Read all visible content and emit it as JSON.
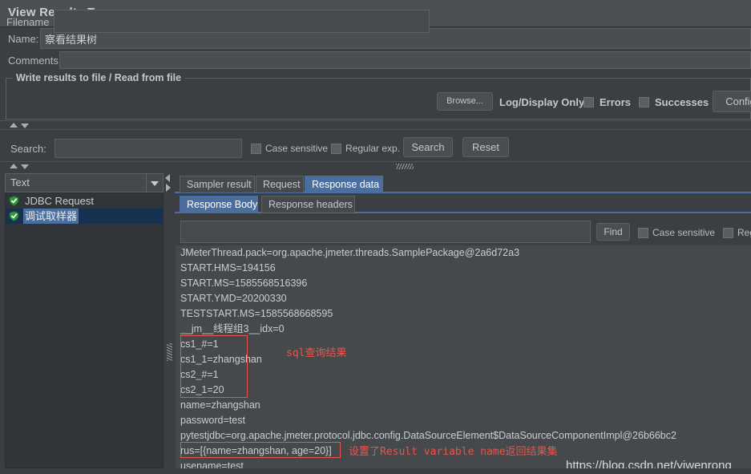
{
  "window": {
    "title": "View Results Tree"
  },
  "form": {
    "name_label": "Name:",
    "name_value": "察看结果树",
    "comments_label": "Comments:",
    "comments_value": ""
  },
  "file_group": {
    "title": "Write results to file / Read from file",
    "filename_label": "Filename",
    "filename_value": "",
    "browse_label": "Browse...",
    "log_display_label": "Log/Display Only:",
    "errors_label": "Errors",
    "errors_checked": false,
    "successes_label": "Successes",
    "successes_checked": false,
    "configure_label": "Config"
  },
  "search_bar": {
    "label": "Search:",
    "value": "",
    "case_sensitive_label": "Case sensitive",
    "case_sensitive_checked": false,
    "regex_label": "Regular exp.",
    "regex_checked": false,
    "search_button": "Search",
    "reset_button": "Reset"
  },
  "tree_panel": {
    "render_combo_value": "Text",
    "items": [
      {
        "label": "JDBC Request",
        "icon": "success-shield-icon",
        "selected": false
      },
      {
        "label": "调试取样器",
        "icon": "success-shield-icon",
        "selected": true
      }
    ]
  },
  "tabs_primary": [
    {
      "label": "Sampler result",
      "active": false
    },
    {
      "label": "Request",
      "active": false
    },
    {
      "label": "Response data",
      "active": true
    }
  ],
  "tabs_secondary": [
    {
      "label": "Response Body",
      "active": true
    },
    {
      "label": "Response headers",
      "active": false
    }
  ],
  "find_bar": {
    "value": "",
    "find_button": "Find",
    "case_sensitive_label": "Case sensitive",
    "case_sensitive_checked": false,
    "regex_label": "Regul",
    "regex_checked": false
  },
  "response_body": {
    "lines": [
      "JMeterThread.pack=org.apache.jmeter.threads.SamplePackage@2a6d72a3",
      "START.HMS=194156",
      "START.MS=1585568516396",
      "START.YMD=20200330",
      "TESTSTART.MS=1585568668595",
      "__jm__线程组3__idx=0",
      "cs1_#=1",
      "cs1_1=zhangshan",
      "cs2_#=1",
      "cs2_1=20",
      "name=zhangshan",
      "password=test",
      "pytestjdbc=org.apache.jmeter.protocol.jdbc.config.DataSourceElement$DataSourceComponentImpl@26b66bc2",
      "rus=[{name=zhangshan, age=20}]",
      "usename=test"
    ]
  },
  "annotations": {
    "sql_result": "sql查询结果",
    "result_variable": "设置了Result variable name返回结果集",
    "watermark": "https://blog.csdn.net/yiwenrong",
    "accent_color": "#e8554d"
  },
  "colors": {
    "background": "#3c3f41",
    "titlebar": "#4b4f51",
    "field": "#474b4d",
    "text": "#c3c8cc",
    "tab_active": "#4a6f9e",
    "tree_background": "#31353a",
    "selection": "#4a6f9e",
    "annotation_red": "#e8554d"
  }
}
